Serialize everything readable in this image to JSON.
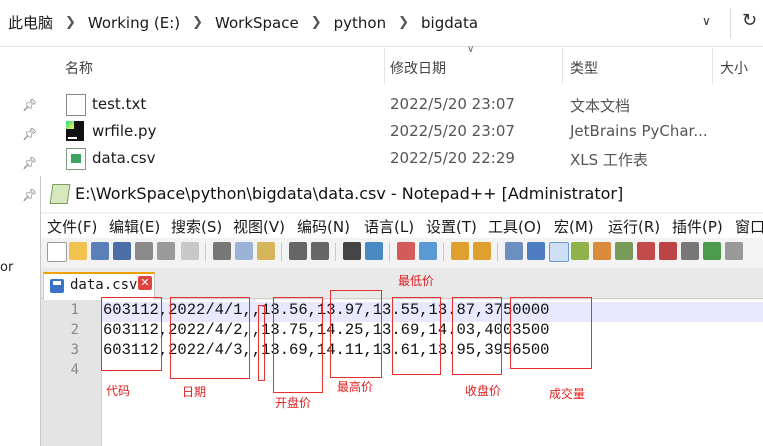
{
  "breadcrumbs": [
    "此电脑",
    "Working (E:)",
    "WorkSpace",
    "python",
    "bigdata"
  ],
  "columns": {
    "name": "名称",
    "date": "修改日期",
    "type": "类型",
    "size": "大小"
  },
  "files": [
    {
      "name": "test.txt",
      "date": "2022/5/20 23:07",
      "type": "文本文档",
      "icon": "text-file-icon"
    },
    {
      "name": "wrfile.py",
      "date": "2022/5/20 23:07",
      "type": "JetBrains PyChar...",
      "icon": "pycharm-file-icon"
    },
    {
      "name": "data.csv",
      "date": "2022/5/20 22:29",
      "type": "XLS 工作表",
      "icon": "csv-file-icon"
    }
  ],
  "left_fragment": "or",
  "notepad": {
    "title": "E:\\WorkSpace\\python\\bigdata\\data.csv - Notepad++ [Administrator]",
    "menu": [
      "文件(F)",
      "编辑(E)",
      "搜索(S)",
      "视图(V)",
      "编码(N)",
      "语言(L)",
      "设置(T)",
      "工具(O)",
      "宏(M)",
      "运行(R)",
      "插件(P)",
      "窗口"
    ],
    "tab": "data.csv",
    "line_numbers": [
      "1",
      "2",
      "3",
      "4"
    ],
    "lines": [
      "603112,2022/4/1,,13.56,13.97,13.55,13.87,3750000",
      "603112,2022/4/2,,13.75,14.25,13.69,14.03,4003500",
      "603112,2022/4/3,,13.69,14.11,13.61,13.95,3956500",
      ""
    ]
  },
  "annotations": {
    "code": "代码",
    "date": "日期",
    "open": "开盘价",
    "high": "最高价",
    "low": "最低价",
    "close": "收盘价",
    "volume": "成交量"
  },
  "colors": {
    "annotation": "#e8302a",
    "tab_accent": "#f0a000",
    "current_line": "#e8e8ff"
  }
}
